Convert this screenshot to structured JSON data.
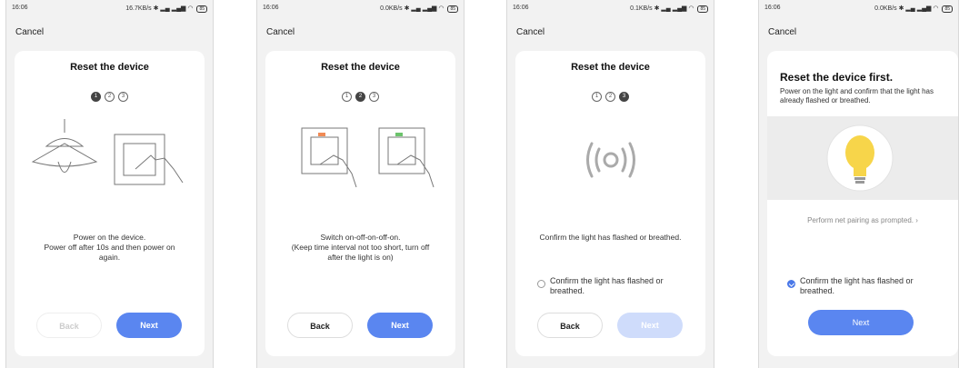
{
  "screens": [
    {
      "status": {
        "time": "16:06",
        "net": "16.7KB/s",
        "battery": "85"
      },
      "cancel": "Cancel",
      "title": "Reset the device",
      "steps": [
        "1",
        "2",
        "3"
      ],
      "desc": [
        "Power on the device.",
        "Power off after 10s and then power on",
        "again."
      ],
      "back": "Back",
      "next": "Next"
    },
    {
      "status": {
        "time": "16:06",
        "net": "0.0KB/s",
        "battery": "85"
      },
      "cancel": "Cancel",
      "title": "Reset the device",
      "steps": [
        "1",
        "2",
        "3"
      ],
      "desc": [
        "Switch on-off-on-off-on.",
        "(Keep time interval not too short, turn off",
        "after the light is on)"
      ],
      "back": "Back",
      "next": "Next"
    },
    {
      "status": {
        "time": "16:06",
        "net": "0.1KB/s",
        "battery": "85"
      },
      "cancel": "Cancel",
      "title": "Reset the device",
      "steps": [
        "1",
        "2",
        "3"
      ],
      "desc": "Confirm the light has flashed or breathed.",
      "confirm": "Confirm the light has flashed or breathed.",
      "back": "Back",
      "next": "Next"
    },
    {
      "status": {
        "time": "16:06",
        "net": "0.0KB/s",
        "battery": "85"
      },
      "cancel": "Cancel",
      "title": "Reset the device first.",
      "subtitle": "Power on the light and confirm that the light has already flashed or breathed.",
      "link": "Perform net pairing as prompted.",
      "confirm": "Confirm the light has flashed or breathed.",
      "next": "Next"
    }
  ],
  "colors": {
    "accent": "#5a86f0",
    "accent_disabled": "#cfdcfb",
    "bulb": "#f7d54a"
  }
}
